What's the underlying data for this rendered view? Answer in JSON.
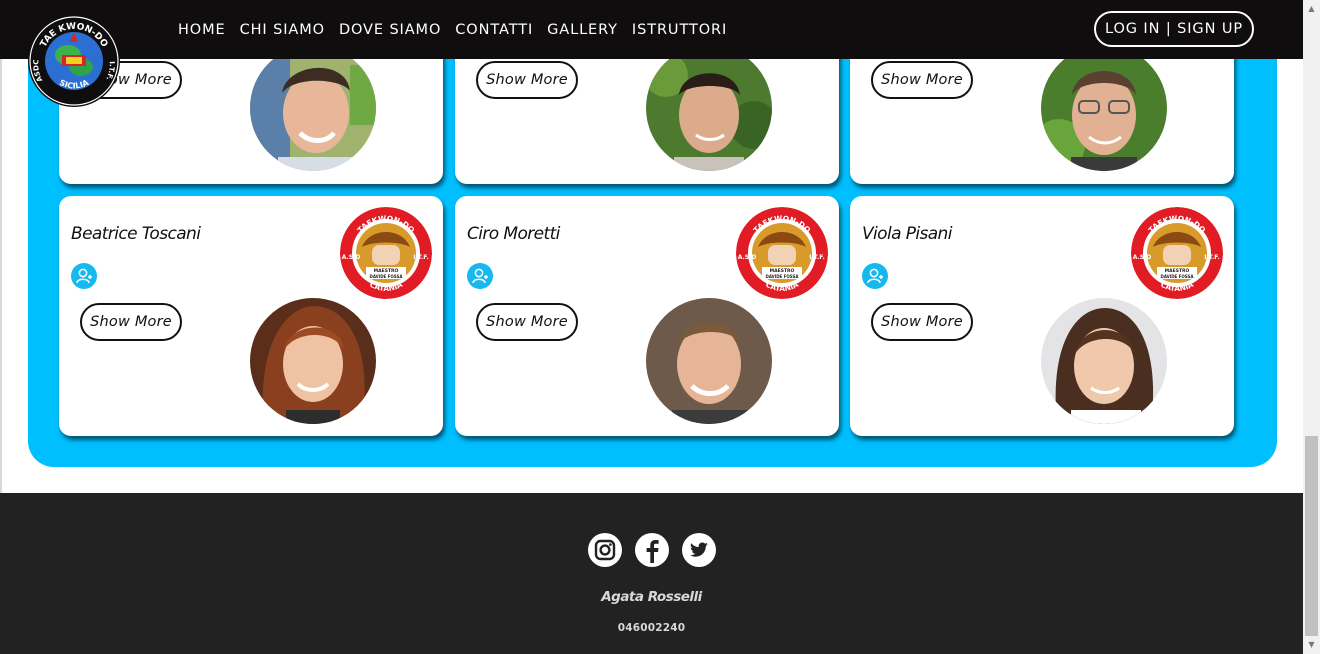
{
  "navbar": {
    "links": [
      "HOME",
      "CHI SIAMO",
      "DOVE SIAMO",
      "CONTATTI",
      "GALLERY",
      "ISTRUTTORI"
    ],
    "login_label": "LOG IN | SIGN UP",
    "logo": {
      "top_text": "TAE KWON-DO",
      "left_text": "ASDC",
      "right_text": "I.T.F.",
      "bottom_text": "SICILIA"
    }
  },
  "cards": [
    {
      "name": "",
      "show_more": "Show More",
      "avatar": "avatar-man-young"
    },
    {
      "name": "",
      "show_more": "Show More",
      "avatar": "avatar-man-dark-hair"
    },
    {
      "name": "",
      "show_more": "Show More",
      "avatar": "avatar-man-glasses"
    },
    {
      "name": "Beatrice Toscani",
      "show_more": "Show More",
      "avatar": "avatar-woman-auburn"
    },
    {
      "name": "Ciro Moretti",
      "show_more": "Show More",
      "avatar": "avatar-man-short-hair"
    },
    {
      "name": "Viola Pisani",
      "show_more": "Show More",
      "avatar": "avatar-girl"
    }
  ],
  "club_logo": {
    "top_text": "TAEKWON-DO",
    "left_text": "A.S.D",
    "right_text": "I.T.F.",
    "line1": "MAESTRO",
    "line2": "DAVIDE FOSSA",
    "bottom_text": "CATANIA"
  },
  "footer": {
    "social": [
      "instagram-icon",
      "facebook-icon",
      "twitter-icon"
    ],
    "name": "Agata Rosselli",
    "phone": "046002240"
  },
  "colors": {
    "navbar": "#0f0d0e",
    "accent_blue": "#00bfff",
    "footer": "#222222",
    "add_user_icon": "#15b9ee",
    "club_red": "#e21c25"
  }
}
